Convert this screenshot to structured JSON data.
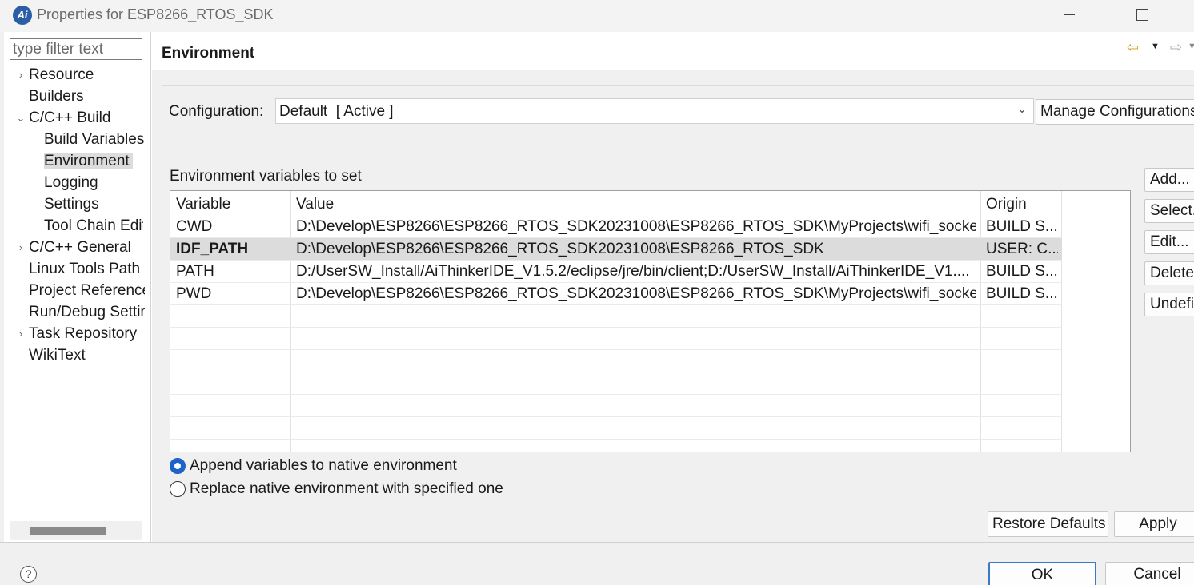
{
  "window": {
    "title": "Properties for ESP8266_RTOS_SDK",
    "logo_text": "Ai"
  },
  "sidebar": {
    "filter_placeholder": "type filter text",
    "items": [
      {
        "label": "Resource",
        "expandable": true,
        "expanded": false
      },
      {
        "label": "Builders"
      },
      {
        "label": "C/C++ Build",
        "expandable": true,
        "expanded": true
      },
      {
        "label": "Build Variables"
      },
      {
        "label": "Environment",
        "selected": true
      },
      {
        "label": "Logging"
      },
      {
        "label": "Settings"
      },
      {
        "label": "Tool Chain Editor"
      },
      {
        "label": "C/C++ General",
        "expandable": true,
        "expanded": false
      },
      {
        "label": "Linux Tools Path"
      },
      {
        "label": "Project References"
      },
      {
        "label": "Run/Debug Settings"
      },
      {
        "label": "Task Repository",
        "expandable": true,
        "expanded": false
      },
      {
        "label": "WikiText"
      }
    ]
  },
  "page": {
    "title": "Environment",
    "nav": {
      "back_icon": "back-arrow-icon",
      "forward_icon": "forward-arrow-icon"
    },
    "configuration": {
      "label": "Configuration:",
      "value": "Default  [ Active ]",
      "manage_label": "Manage Configurations..."
    },
    "env_section_label": "Environment variables to set",
    "table": {
      "columns": [
        "Variable",
        "Value",
        "Origin"
      ],
      "rows": [
        {
          "variable": "CWD",
          "value": "D:\\Develop\\ESP8266\\ESP8266_RTOS_SDK20231008\\ESP8266_RTOS_SDK\\MyProjects\\wifi_socket",
          "origin": "BUILD S..."
        },
        {
          "variable": "IDF_PATH",
          "value": "D:\\Develop\\ESP8266\\ESP8266_RTOS_SDK20231008\\ESP8266_RTOS_SDK",
          "origin": "USER: C...",
          "selected": true
        },
        {
          "variable": "PATH",
          "value": "D:/UserSW_Install/AiThinkerIDE_V1.5.2/eclipse/jre/bin/client;D:/UserSW_Install/AiThinkerIDE_V1....",
          "origin": "BUILD S..."
        },
        {
          "variable": "PWD",
          "value": "D:\\Develop\\ESP8266\\ESP8266_RTOS_SDK20231008\\ESP8266_RTOS_SDK\\MyProjects\\wifi_socket",
          "origin": "BUILD S..."
        }
      ]
    },
    "side_buttons": [
      "Add...",
      "Select...",
      "Edit...",
      "Delete",
      "Undefine"
    ],
    "radios": [
      {
        "label": "Append variables to native environment",
        "checked": true
      },
      {
        "label": "Replace native environment with specified one",
        "checked": false
      }
    ],
    "restore_defaults": "Restore Defaults",
    "apply": "Apply"
  },
  "footer": {
    "help_icon": "?",
    "ok": "OK",
    "cancel": "Cancel"
  },
  "colors": {
    "accent": "#1c62c8",
    "selection": "#dcdcdc",
    "nav_back": "#d89a1c"
  }
}
